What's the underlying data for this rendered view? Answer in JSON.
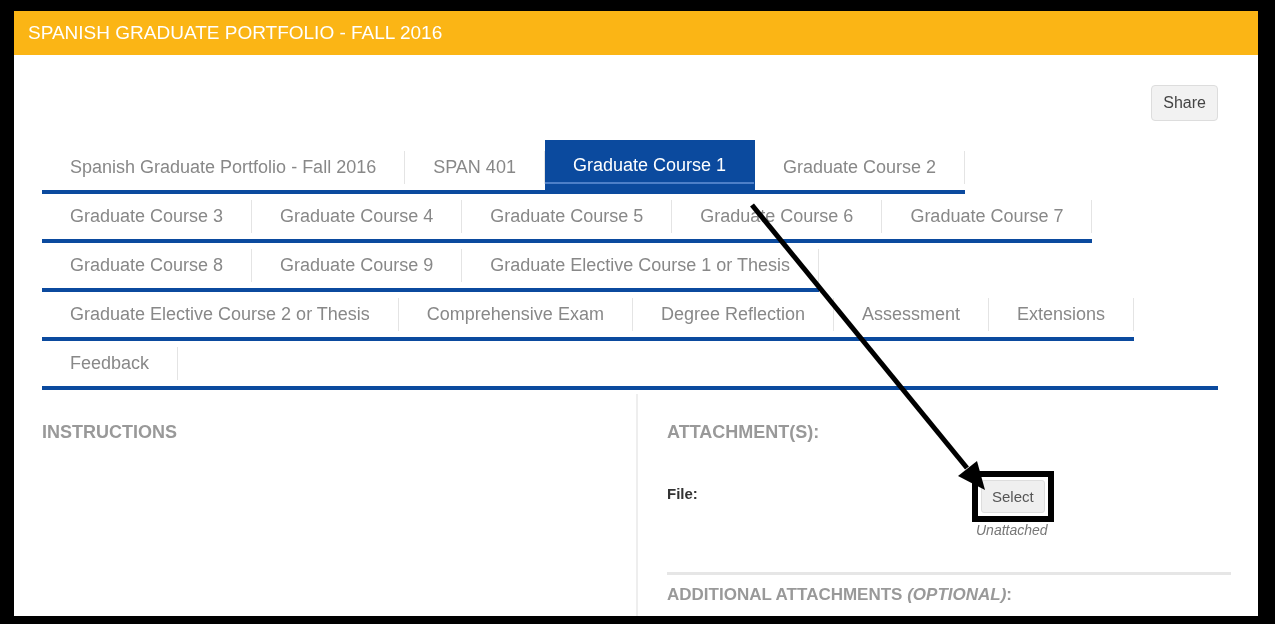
{
  "header": {
    "title": "SPANISH GRADUATE PORTFOLIO - FALL 2016"
  },
  "share_button": "Share",
  "tab_rows": [
    [
      {
        "label": "Spanish Graduate Portfolio - Fall 2016",
        "selected": false
      },
      {
        "label": "SPAN 401",
        "selected": false
      },
      {
        "label": "Graduate Course 1",
        "selected": true
      },
      {
        "label": "Graduate Course 2",
        "selected": false
      }
    ],
    [
      {
        "label": "Graduate Course 3",
        "selected": false
      },
      {
        "label": "Graduate Course 4",
        "selected": false
      },
      {
        "label": "Graduate Course 5",
        "selected": false
      },
      {
        "label": "Graduate Course 6",
        "selected": false
      },
      {
        "label": "Graduate Course 7",
        "selected": false
      }
    ],
    [
      {
        "label": "Graduate Course 8",
        "selected": false
      },
      {
        "label": "Graduate Course 9",
        "selected": false
      },
      {
        "label": "Graduate Elective Course 1 or Thesis",
        "selected": false
      }
    ],
    [
      {
        "label": "Graduate Elective Course 2 or Thesis",
        "selected": false
      },
      {
        "label": "Comprehensive Exam",
        "selected": false
      },
      {
        "label": "Degree Reflection",
        "selected": false
      },
      {
        "label": "Assessment",
        "selected": false
      },
      {
        "label": "Extensions",
        "selected": false
      }
    ],
    [
      {
        "label": "Feedback",
        "selected": false
      }
    ]
  ],
  "instructions": {
    "heading": "INSTRUCTIONS"
  },
  "attachments": {
    "heading": "ATTACHMENT(S):",
    "file_label": "File:",
    "select_button": "Select",
    "status": "Unattached",
    "additional_heading": "ADDITIONAL ATTACHMENTS *(OPTIONAL)*:"
  }
}
